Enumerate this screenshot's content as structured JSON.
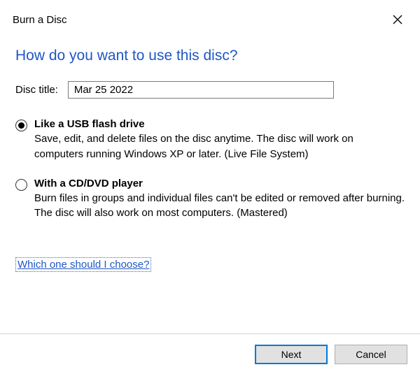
{
  "window": {
    "title": "Burn a Disc"
  },
  "heading": "How do you want to use this disc?",
  "disc_title_label": "Disc title:",
  "disc_title_value": "Mar 25 2022",
  "options": {
    "usb": {
      "title": "Like a USB flash drive",
      "desc": "Save, edit, and delete files on the disc anytime. The disc will work on computers running Windows XP or later. (Live File System)"
    },
    "cddvd": {
      "title": "With a CD/DVD player",
      "desc": "Burn files in groups and individual files can't be edited or removed after burning. The disc will also work on most computers. (Mastered)"
    }
  },
  "help_link": "Which one should I choose?",
  "buttons": {
    "next": "Next",
    "cancel": "Cancel"
  }
}
